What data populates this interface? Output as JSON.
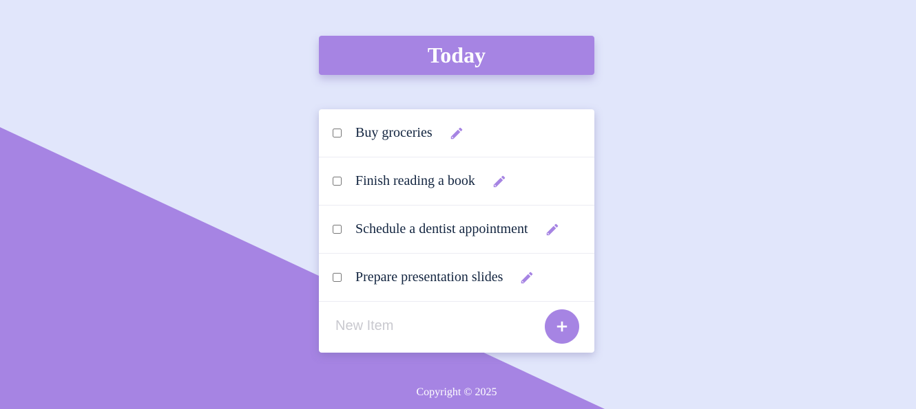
{
  "header": {
    "title": "Today"
  },
  "todo": {
    "items": [
      {
        "label": "Buy groceries",
        "checked": false,
        "edit_icon": "pencil-icon"
      },
      {
        "label": "Finish reading a book",
        "checked": false,
        "edit_icon": "pencil-icon"
      },
      {
        "label": "Schedule a dentist appointment",
        "checked": false,
        "edit_icon": "pencil-icon"
      },
      {
        "label": "Prepare presentation slides",
        "checked": false,
        "edit_icon": "pencil-icon"
      }
    ],
    "new_item": {
      "placeholder": "New Item",
      "value": "",
      "add_icon": "plus-icon"
    }
  },
  "footer": {
    "text": "Copyright © 2025"
  },
  "colors": {
    "background": "#e1e6fb",
    "accent": "#a684e3",
    "text": "#12243f"
  }
}
